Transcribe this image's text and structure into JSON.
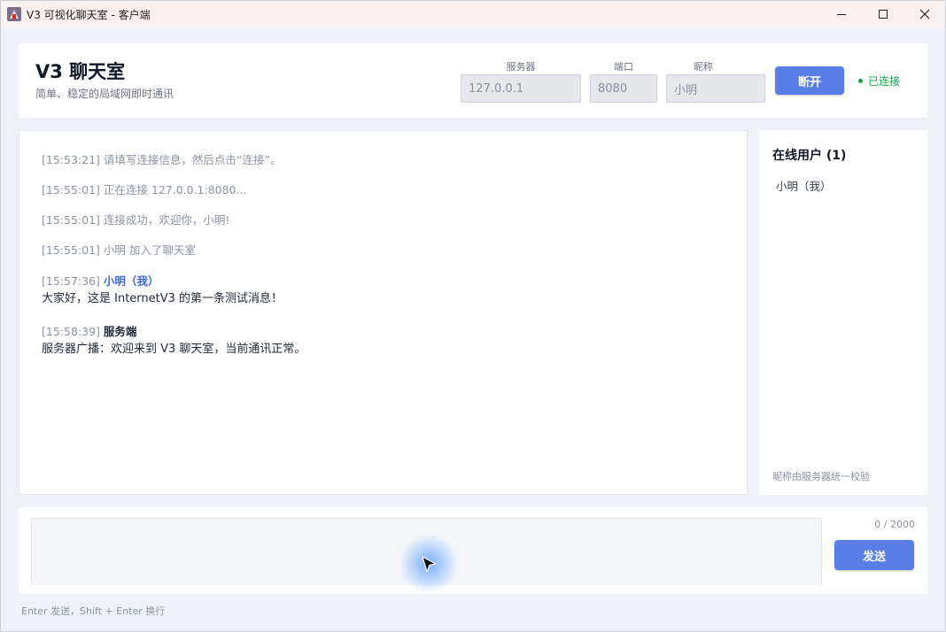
{
  "window": {
    "title": "V3 可视化聊天室 - 客户端",
    "icons": [
      "app-icon",
      "minimize-icon",
      "maximize-icon",
      "close-icon"
    ]
  },
  "header": {
    "title": "V3 聊天室",
    "subtitle": "简单、稳定的局域网即时通讯",
    "server_label": "服务器",
    "server_value": "127.0.0.1",
    "port_label": "端口",
    "port_value": "8080",
    "nickname_label": "昵称",
    "nickname_value": "小明",
    "disconnect_label": "断开",
    "status_text": "已连接",
    "status_color": "#16a34a",
    "accent_color": "#5b7ee6"
  },
  "messages": {
    "m1": {
      "time": "[15:53:21]",
      "text": "请填写连接信息，然后点击“连接”。"
    },
    "m2": {
      "time": "[15:55:01]",
      "text": "正在连接 127.0.0.1:8080..."
    },
    "m3": {
      "time": "[15:55:01]",
      "text": "连接成功，欢迎你，小明!"
    },
    "m4": {
      "time": "[15:55:01]",
      "text": "小明 加入了聊天室"
    },
    "m5": {
      "time": "[15:57:36]",
      "sender": "小明（我）",
      "body": "大家好，这是 InternetV3 的第一条测试消息！"
    },
    "m6": {
      "time": "[15:58:39]",
      "sender": "服务端",
      "body": "服务器广播：欢迎来到 V3 聊天室，当前通讯正常。"
    }
  },
  "users": {
    "title": "在线用户 (1)",
    "list": [
      "小明（我）"
    ],
    "footnote": "昵称由服务器统一校验"
  },
  "composer": {
    "value": "",
    "char_count": "0 / 2000",
    "send_label": "发送",
    "hint": "Enter 发送，Shift + Enter 换行"
  }
}
